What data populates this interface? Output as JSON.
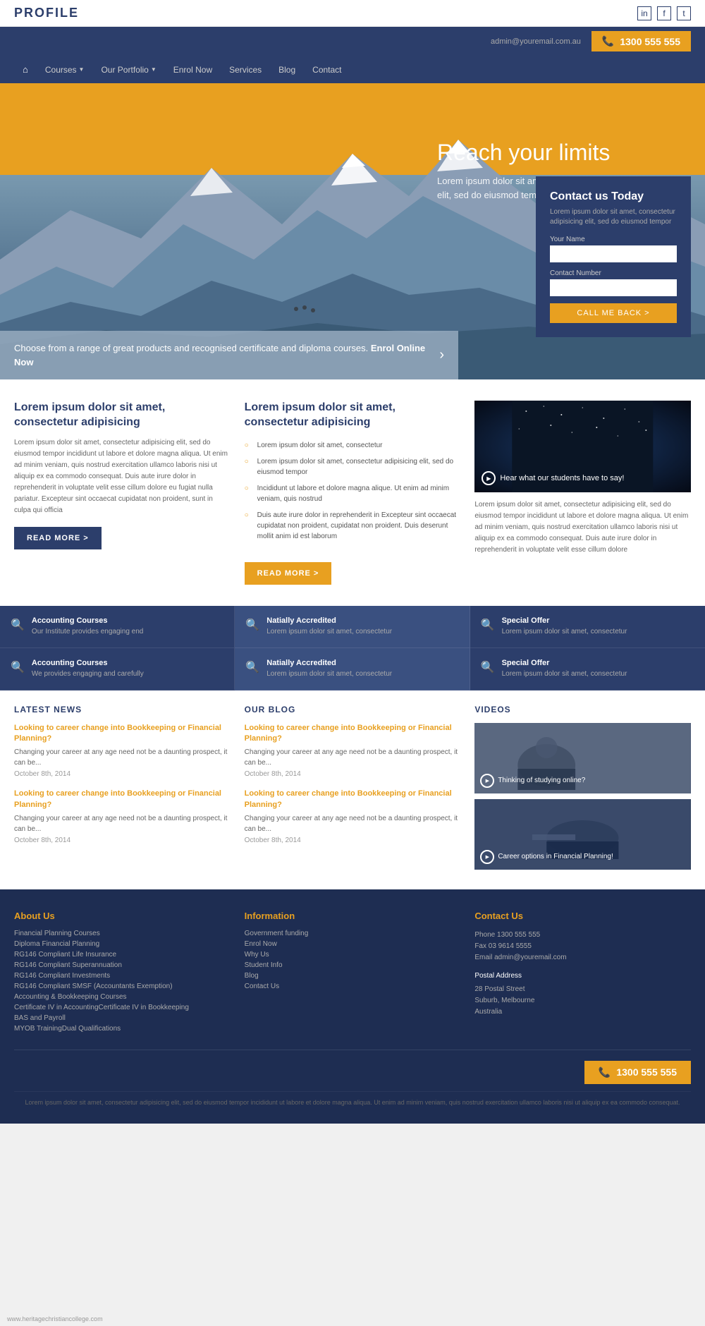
{
  "header": {
    "logo": "PROFILE",
    "social": [
      "in",
      "f",
      "t"
    ],
    "email": "admin@youremail.com.au",
    "phone": "1300 555 555"
  },
  "nav": {
    "home_icon": "⌂",
    "items": [
      {
        "label": "Courses",
        "has_dropdown": true
      },
      {
        "label": "Our Portfolio",
        "has_dropdown": true
      },
      {
        "label": "Enrol Now",
        "has_dropdown": false
      },
      {
        "label": "Services",
        "has_dropdown": false
      },
      {
        "label": "Blog",
        "has_dropdown": false
      },
      {
        "label": "Contact",
        "has_dropdown": false
      }
    ]
  },
  "hero": {
    "title": "Reach your limits",
    "subtitle": "Lorem ipsum dolor sit amet, consectetur adipisicing elit, sed do eiusmod tempor",
    "bottom_text": "Choose from a range of great products and recognised certificate and diploma courses.",
    "bottom_link": "Enrol Online Now",
    "contact_form": {
      "title": "Contact us Today",
      "subtitle": "Lorem ipsum dolor sit amet, consectetur adipisicing elit, sed do eiusmod tempor",
      "name_label": "Your Name",
      "phone_label": "Contact Number",
      "button": "CALL ME BACK >"
    },
    "video_label": "Hear what our students have to say!"
  },
  "content": {
    "col1": {
      "title": "Lorem ipsum dolor sit amet, consectetur adipisicing",
      "text": "Lorem ipsum dolor sit amet, consectetur adipisicing elit, sed do eiusmod tempor incididunt ut labore et dolore magna aliqua. Ut enim ad minim veniam, quis nostrud exercitation ullamco laboris nisi ut aliquip ex ea commodo consequat. Duis aute irure dolor in reprehenderit in voluptate velit esse cillum dolore eu fugiat nulla pariatur. Excepteur sint occaecat cupidatat non proident, sunt in culpa qui officia",
      "button": "READ MORE >"
    },
    "col2": {
      "title": "Lorem ipsum dolor sit amet, consectetur adipisicing",
      "bullets": [
        "Lorem ipsum dolor sit amet, consectetur",
        "Lorem ipsum dolor sit amet, consectetur adipisicing elit, sed do eiusmod tempor",
        "Incididunt ut labore et dolore magna alique. Ut enim ad minim veniam, quis nostrud",
        "Duis aute irure dolor in reprehenderit in Excepteur sint occaecat cupidatat non proident, cupidatat non proident. Duis deserunt mollit anim id est laborum"
      ],
      "button": "READ MORE >"
    },
    "col3": {
      "video_label": "Hear what our students have to say!",
      "text": "Lorem ipsum dolor sit amet, consectetur adipisicing elit, sed do eiusmod tempor incididunt ut labore et dolore magna aliqua. Ut enim ad minim veniam, quis nostrud exercitation ullamco laboris nisi ut aliquip ex ea commodo consequat. Duis aute irure dolor in reprehenderit in voluptate velit esse cillum dolore"
    }
  },
  "features": [
    {
      "title": "Accounting Courses",
      "text": "Our Institute provides engaging end",
      "icon": "🔍"
    },
    {
      "title": "Natially Accredited",
      "text": "Lorem ipsum dolor sit amet, consectetur",
      "icon": "🔍",
      "accent": true
    },
    {
      "title": "Special Offer",
      "text": "Lorem ipsum dolor sit amet, consectetur",
      "icon": "🔍"
    },
    {
      "title": "Accounting Courses",
      "text": "We provides engaging and carefully",
      "icon": "🔍"
    },
    {
      "title": "Natially Accredited",
      "text": "Lorem ipsum dolor sit amet, consectetur",
      "icon": "🔍",
      "accent": true
    },
    {
      "title": "Special Offer",
      "text": "Lorem ipsum dolor sit amet, consectetur",
      "icon": "🔍"
    }
  ],
  "news": {
    "title": "LATEST NEWS",
    "items": [
      {
        "title": "Looking to career change into Bookkeeping or Financial Planning?",
        "text": "Changing your career at any age need not be a daunting prospect, it can be...",
        "date": "October 8th, 2014"
      },
      {
        "title": "Looking to career change into Bookkeeping or Financial Planning?",
        "text": "Changing your career at any age need not be a daunting prospect, it can be...",
        "date": "October 8th, 2014"
      }
    ]
  },
  "blog": {
    "title": "OUR BLOG",
    "items": [
      {
        "title": "Looking to career change into Bookkeeping or Financial Planning?",
        "text": "Changing your career at any age need not be a daunting prospect, it can be...",
        "date": "October 8th, 2014"
      },
      {
        "title": "Looking to career change into Bookkeeping or Financial Planning?",
        "text": "Changing your career at any age need not be a daunting prospect, it can be...",
        "date": "October 8th, 2014"
      }
    ]
  },
  "videos": {
    "title": "VIDEOS",
    "items": [
      {
        "label": "Thinking of studying online?"
      },
      {
        "label": "Career options in Financial Planning!"
      }
    ]
  },
  "footer": {
    "about_title": "About Us",
    "about_links": [
      "Financial Planning Courses",
      "Diploma Financial Planning",
      "RG146 Compliant Life Insurance",
      "RG146 Compliant Superannuation",
      "RG146 Compliant Investments",
      "RG146 Compliant SMSF (Accountants Exemption)",
      "Accounting & Bookkeeping Courses",
      "Certificate IV in AccountingCertificate IV in Bookkeeping",
      "BAS and Payroll",
      "MYOB TrainingDual Qualifications"
    ],
    "info_title": "Information",
    "info_links": [
      "Government funding",
      "Enrol Now",
      "Why Us",
      "Student Info",
      "Blog",
      "Contact Us"
    ],
    "contact_title": "Contact Us",
    "contact_details": [
      "Phone 1300 555 555",
      "Fax 03 9614 5555",
      "Email admin@youremail.com",
      "",
      "Postal Address",
      "28 Postal Street",
      "Suburb, Melbourne",
      "Australia"
    ],
    "phone": "1300 555 555",
    "copyright": "Lorem ipsum dolor sit amet, consectetur adipisicing elit, sed do eiusmod tempor incididunt ut labore et dolore magna aliqua. Ut enim ad minim veniam, quis nostrud exercitation ullamco laboris nisi ut aliquip ex ea commodo consequat.",
    "website": "www.heritagechristiancollege.com"
  }
}
